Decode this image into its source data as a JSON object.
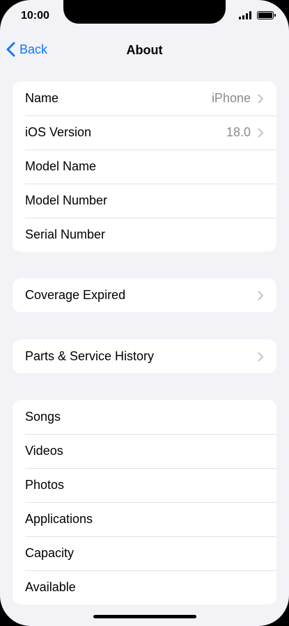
{
  "status_bar": {
    "time": "10:00"
  },
  "nav": {
    "back_label": "Back",
    "title": "About"
  },
  "groups": [
    {
      "rows": [
        {
          "label": "Name",
          "value": "iPhone",
          "chevron": true
        },
        {
          "label": "iOS Version",
          "value": "18.0",
          "chevron": true
        },
        {
          "label": "Model Name",
          "value": "",
          "chevron": false
        },
        {
          "label": "Model Number",
          "value": "",
          "chevron": false
        },
        {
          "label": "Serial Number",
          "value": "",
          "chevron": false
        }
      ]
    },
    {
      "rows": [
        {
          "label": "Coverage Expired",
          "value": "",
          "chevron": true
        }
      ]
    },
    {
      "rows": [
        {
          "label": "Parts & Service History",
          "value": "",
          "chevron": true
        }
      ]
    },
    {
      "rows": [
        {
          "label": "Songs",
          "value": "",
          "chevron": false
        },
        {
          "label": "Videos",
          "value": "",
          "chevron": false
        },
        {
          "label": "Photos",
          "value": "",
          "chevron": false
        },
        {
          "label": "Applications",
          "value": "",
          "chevron": false
        },
        {
          "label": "Capacity",
          "value": "",
          "chevron": false
        },
        {
          "label": "Available",
          "value": "",
          "chevron": false
        }
      ]
    }
  ],
  "colors": {
    "accent": "#0a7aff",
    "background": "#f2f2f7",
    "secondary_text": "#8a8a8e"
  }
}
